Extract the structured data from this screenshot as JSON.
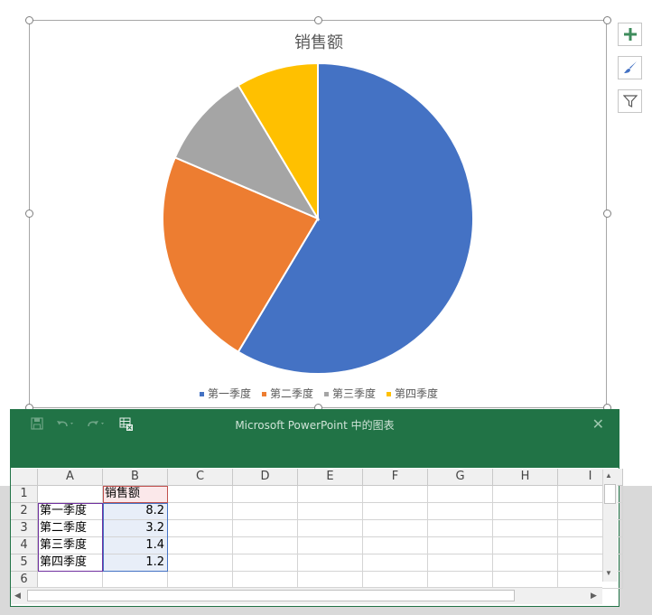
{
  "chart": {
    "title": "销售额"
  },
  "chart_data": {
    "type": "pie",
    "title": "销售额",
    "categories": [
      "第一季度",
      "第二季度",
      "第三季度",
      "第四季度"
    ],
    "values": [
      8.2,
      3.2,
      1.4,
      1.2
    ],
    "colors": [
      "#4472c4",
      "#ed7d31",
      "#a5a5a5",
      "#ffc000"
    ],
    "legend_position": "bottom"
  },
  "side_buttons": [
    {
      "icon": "plus-icon"
    },
    {
      "icon": "brush-icon"
    },
    {
      "icon": "filter-icon"
    }
  ],
  "excel": {
    "window_title": "Microsoft PowerPoint 中的图表",
    "close_glyph": "✕",
    "columns": [
      "A",
      "B",
      "C",
      "D",
      "E",
      "F",
      "G",
      "H",
      "I"
    ],
    "rows": [
      "1",
      "2",
      "3",
      "4",
      "5",
      "6"
    ],
    "cells": {
      "B1": "销售额",
      "A2": "第一季度",
      "B2": "8.2",
      "A3": "第二季度",
      "B3": "3.2",
      "A4": "第三季度",
      "B4": "1.4",
      "A5": "第四季度",
      "B5": "1.2"
    }
  }
}
